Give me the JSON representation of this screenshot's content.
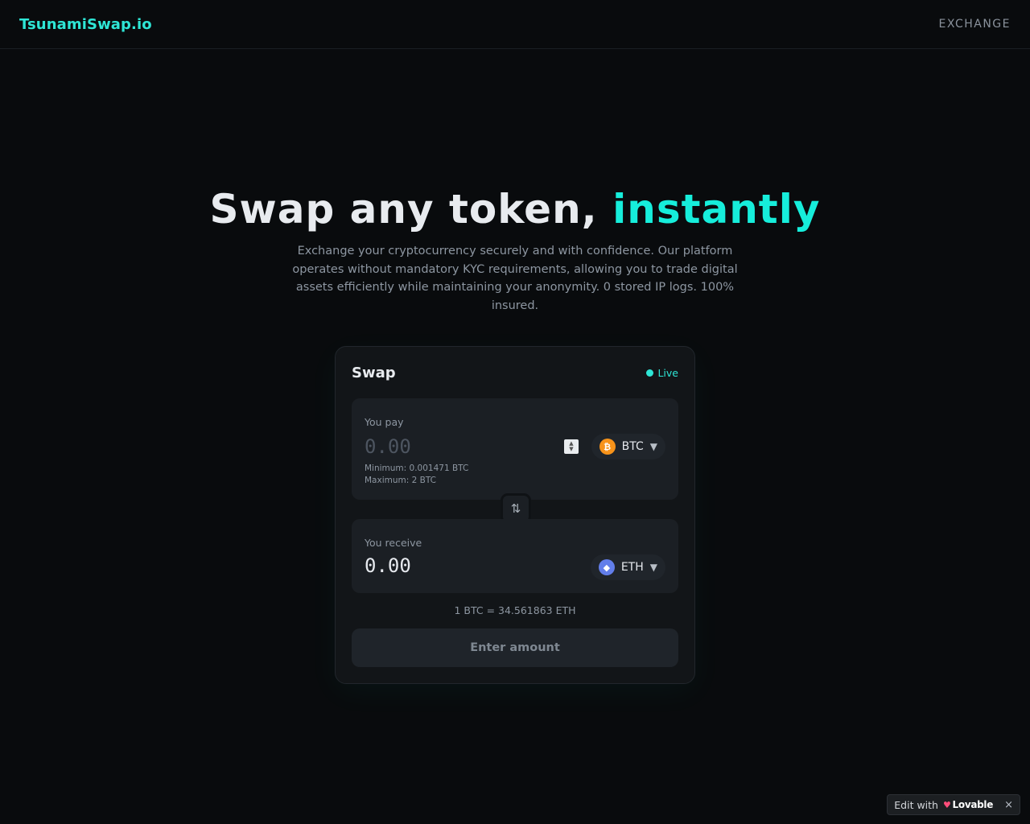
{
  "header": {
    "logo": "TsunamiSwap.io",
    "nav_exchange": "EXCHANGE"
  },
  "hero": {
    "title_main": "Swap any token, ",
    "title_accent": "instantly",
    "subtitle": "Exchange your cryptocurrency securely and with confidence. Our platform operates without mandatory KYC requirements, allowing you to trade digital assets efficiently while maintaining your anonymity. 0 stored IP logs. 100% insured."
  },
  "swap": {
    "title": "Swap",
    "status": "Live",
    "pay": {
      "label": "You pay",
      "placeholder": "0.00",
      "token": "BTC",
      "min": "Minimum: 0.001471 BTC",
      "max": "Maximum: 2 BTC"
    },
    "receive": {
      "label": "You receive",
      "amount": "0.00",
      "token": "ETH"
    },
    "rate": "1 BTC = 34.561863 ETH",
    "cta": "Enter amount"
  },
  "badge": {
    "edit_with": "Edit with",
    "brand": "Lovable",
    "close": "×"
  },
  "icons": {
    "btc": "₿",
    "eth": "◆",
    "swap_direction": "⇅",
    "caret": "▼",
    "spinner_up": "▲",
    "spinner_down": "▼",
    "heart": "♥"
  },
  "colors": {
    "accent": "#16eedb",
    "background": "#090b0d",
    "card": "#121518",
    "btc": "#f7931a",
    "eth": "#627eea"
  }
}
